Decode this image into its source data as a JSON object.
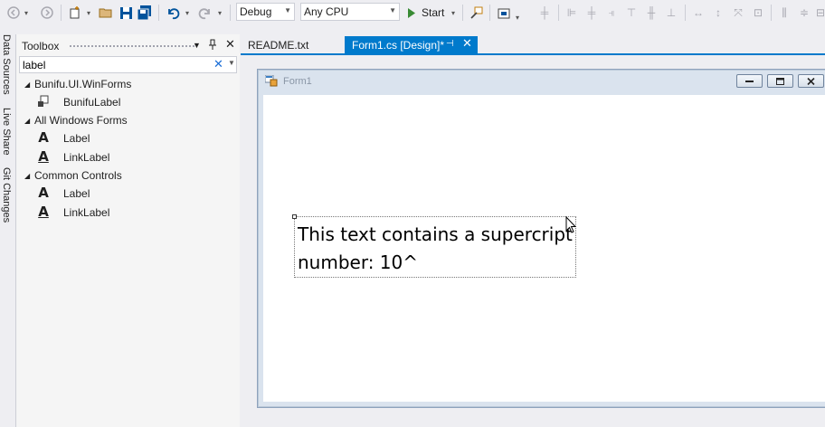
{
  "toolbar": {
    "configuration": "Debug",
    "platform": "Any CPU",
    "start_label": "Start",
    "accent": "#007acc"
  },
  "side_tabs": [
    "Data Sources",
    "Live Share",
    "Git Changes"
  ],
  "toolbox": {
    "title": "Toolbox",
    "search_value": "label",
    "groups": [
      {
        "label": "Bunifu.UI.WinForms",
        "items": [
          {
            "label": "BunifuLabel",
            "icon": "bunifu-label-icon"
          }
        ]
      },
      {
        "label": "All Windows Forms",
        "items": [
          {
            "label": "Label",
            "icon": "label-icon"
          },
          {
            "label": "LinkLabel",
            "icon": "linklabel-icon"
          }
        ]
      },
      {
        "label": "Common Controls",
        "items": [
          {
            "label": "Label",
            "icon": "label-icon"
          },
          {
            "label": "LinkLabel",
            "icon": "linklabel-icon"
          }
        ]
      }
    ]
  },
  "tabs": {
    "readme": "README.txt",
    "form1": "Form1.cs [Design]*"
  },
  "form": {
    "title": "Form1",
    "label_text": "This text contains a supercript number: 10^"
  }
}
